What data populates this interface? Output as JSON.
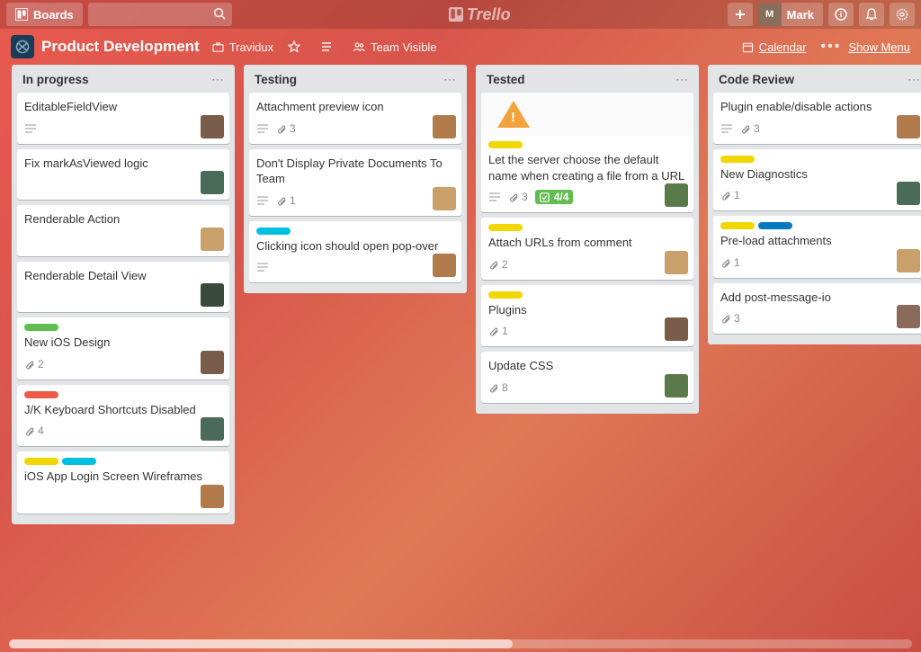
{
  "topbar": {
    "boards_label": "Boards",
    "user_name": "Mark"
  },
  "logo_text": "Trello",
  "boardbar": {
    "title": "Product Development",
    "team": "Travidux",
    "visibility": "Team Visible",
    "calendar": "Calendar",
    "show_menu": "Show Menu"
  },
  "colors": {
    "green": "#61bd4f",
    "yellow": "#f2d600",
    "orange": "#ffab4a",
    "red": "#eb5a46",
    "blue": "#0079bf",
    "sky": "#00c2e0"
  },
  "lists": [
    {
      "title": "In progress",
      "cards": [
        {
          "title": "EditableFieldView",
          "badges": {
            "description": true
          },
          "member": "A"
        },
        {
          "title": "Fix markAsViewed logic",
          "member": "B"
        },
        {
          "title": "Renderable Action",
          "member": "C"
        },
        {
          "title": "Renderable Detail View",
          "member": "D"
        },
        {
          "labels": [
            "green"
          ],
          "title": "New iOS Design",
          "badges": {
            "attachments": 2
          },
          "member": "A"
        },
        {
          "labels": [
            "red"
          ],
          "title": "J/K Keyboard Shortcuts Disabled",
          "badges": {
            "attachments": 4
          },
          "member": "B"
        },
        {
          "labels": [
            "yellow",
            "sky"
          ],
          "title": "iOS App Login Screen Wireframes",
          "member": "E"
        }
      ]
    },
    {
      "title": "Testing",
      "cards": [
        {
          "title": "Attachment preview icon",
          "badges": {
            "description": true,
            "attachments": 3
          },
          "member": "E"
        },
        {
          "title": "Don't Display Private Documents To Team",
          "badges": {
            "description": true,
            "attachments": 1
          },
          "member": "C"
        },
        {
          "labels": [
            "sky"
          ],
          "title": "Clicking icon should open pop-over",
          "badges": {
            "description": true
          },
          "member": "E"
        }
      ]
    },
    {
      "title": "Tested",
      "cards": [
        {
          "cover": "warning",
          "labels": [
            "yellow"
          ],
          "title": "Let the server choose the default name when creating a file from a URL",
          "badges": {
            "description": true,
            "attachments": 3,
            "checklist": "4/4"
          },
          "member": "F"
        },
        {
          "labels": [
            "yellow"
          ],
          "title": "Attach URLs from comment",
          "badges": {
            "attachments": 2
          },
          "member": "C"
        },
        {
          "labels": [
            "yellow"
          ],
          "title": "Plugins",
          "badges": {
            "attachments": 1
          },
          "member": "A"
        },
        {
          "title": "Update CSS",
          "badges": {
            "attachments": 8
          },
          "member": "F"
        }
      ]
    },
    {
      "title": "Code Review",
      "cards": [
        {
          "title": "Plugin enable/disable actions",
          "badges": {
            "description": true,
            "attachments": 3
          },
          "member": "E"
        },
        {
          "labels": [
            "yellow"
          ],
          "title": "New Diagnostics",
          "badges": {
            "attachments": 1
          },
          "member": "B"
        },
        {
          "labels": [
            "yellow",
            "blue"
          ],
          "title": "Pre-load attachments",
          "badges": {
            "attachments": 1
          },
          "member": "C"
        },
        {
          "title": "Add post-message-io",
          "badges": {
            "attachments": 3
          },
          "member": "G"
        }
      ]
    }
  ]
}
